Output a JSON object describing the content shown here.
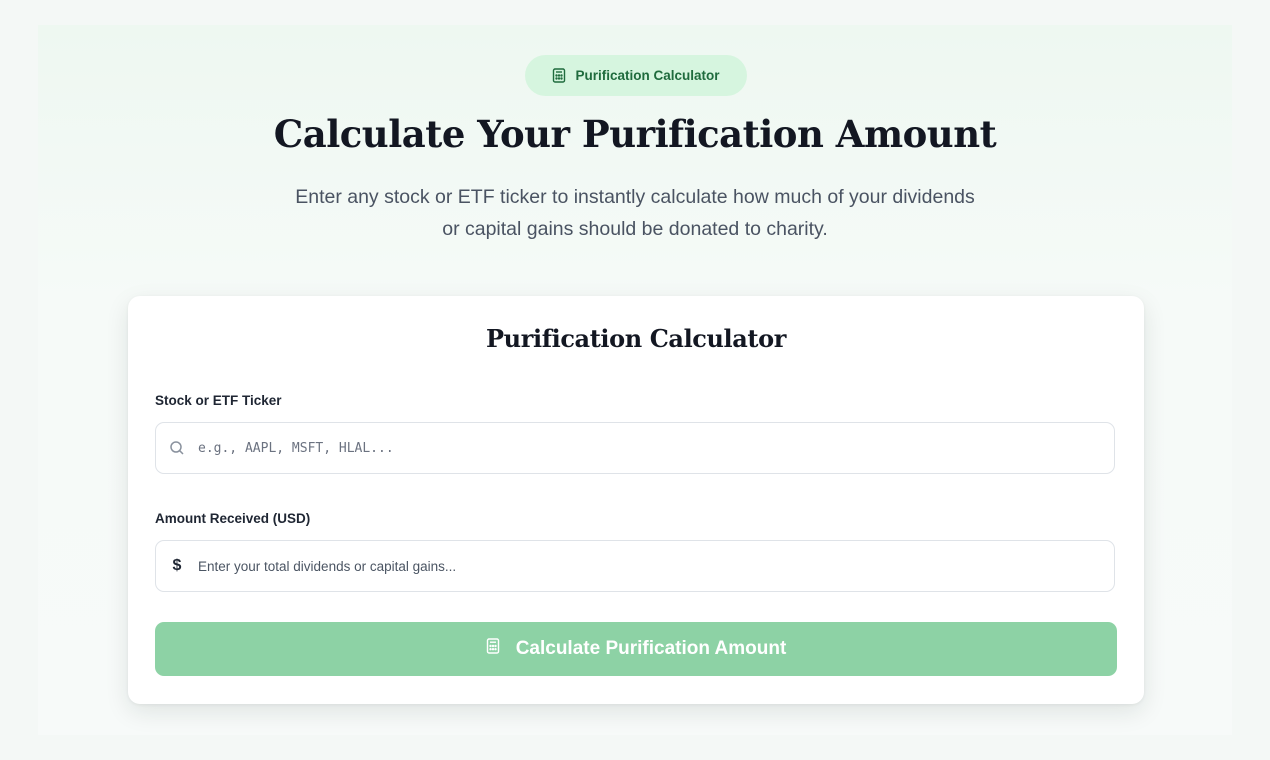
{
  "badge": {
    "label": "Purification Calculator",
    "icon": "calculator-icon"
  },
  "hero": {
    "title": "Calculate Your Purification Amount",
    "subtitle": "Enter any stock or ETF ticker to instantly calculate how much of your dividends or capital gains should be donated to charity."
  },
  "calculator": {
    "title": "Purification Calculator",
    "ticker": {
      "label": "Stock or ETF Ticker",
      "placeholder": "e.g., AAPL, MSFT, HLAL...",
      "value": "",
      "icon": "search-icon"
    },
    "amount": {
      "label": "Amount Received (USD)",
      "prefix": "$",
      "placeholder": "Enter your total dividends or capital gains...",
      "value": ""
    },
    "submit": {
      "label": "Calculate Purification Amount",
      "icon": "calculator-icon",
      "disabled": true
    }
  },
  "colors": {
    "accent": "#1f6b3d",
    "badge_bg": "#d6f5df",
    "button_disabled": "#8dd2a5",
    "heading": "#131722",
    "body_text": "#4a5362"
  }
}
